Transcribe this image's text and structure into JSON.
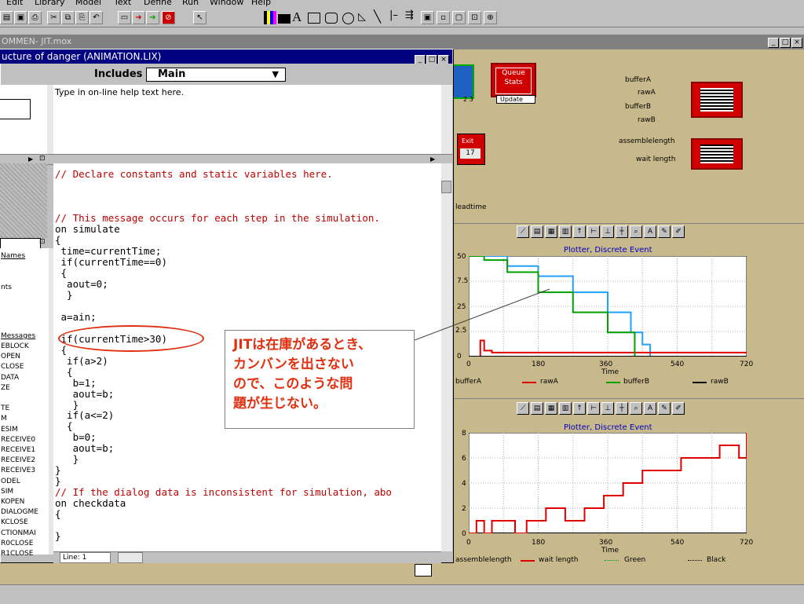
{
  "menubar": {
    "items": [
      "Edit",
      "Library",
      "Model",
      "Text",
      "Define",
      "Run",
      "Window",
      "Help"
    ]
  },
  "model_window": {
    "title": "OMMEN- JIT.mox"
  },
  "dialog": {
    "title": "ucture of danger (ANIMATION.LIX)",
    "includes_label": "Includes",
    "includes_value": "Main",
    "help_text": "Type in on-line help text here.",
    "line_label": "Line: 1",
    "side_links": {
      "names": "Names",
      "ents": "nts",
      "messages": "Messages"
    },
    "message_list": [
      "EBLOCK",
      "OPEN",
      "CLOSE",
      "DATA",
      "ZE",
      "",
      "TE",
      "M",
      "ESIM",
      "RECEIVE0",
      "RECEIVE1",
      "RECEIVE2",
      "RECEIVE3",
      "ODEL",
      "SIM",
      "KOPEN",
      "DIALOGME",
      "KCLOSE",
      "CTIONMAI",
      "R0CLOSE",
      "R1CLOSE"
    ],
    "code_lines": [
      {
        "text": "// Declare constants and static variables here.",
        "comment": true
      },
      {
        "text": "",
        "comment": false
      },
      {
        "text": "",
        "comment": false
      },
      {
        "text": "// This message occurs for each step in the simulation.",
        "comment": true
      },
      {
        "text": "on simulate",
        "comment": false
      },
      {
        "text": "{",
        "comment": false
      },
      {
        "text": " time=currentTime;",
        "comment": false
      },
      {
        "text": " if(currentTime==0)",
        "comment": false
      },
      {
        "text": " {",
        "comment": false
      },
      {
        "text": "  aout=0;",
        "comment": false
      },
      {
        "text": "  }",
        "comment": false
      },
      {
        "text": "",
        "comment": false
      },
      {
        "text": " a=ain;",
        "comment": false
      },
      {
        "text": "",
        "comment": false
      },
      {
        "text": " if(currentTime>30)",
        "comment": false
      },
      {
        "text": " {",
        "comment": false
      },
      {
        "text": "  if(a>2)",
        "comment": false
      },
      {
        "text": "  {",
        "comment": false
      },
      {
        "text": "   b=1;",
        "comment": false
      },
      {
        "text": "   aout=b;",
        "comment": false
      },
      {
        "text": "   }",
        "comment": false
      },
      {
        "text": "  if(a<=2)",
        "comment": false
      },
      {
        "text": "  {",
        "comment": false
      },
      {
        "text": "   b=0;",
        "comment": false
      },
      {
        "text": "   aout=b;",
        "comment": false
      },
      {
        "text": "   }",
        "comment": false
      },
      {
        "text": "}",
        "comment": false
      },
      {
        "text": "}",
        "comment": false
      },
      {
        "text": "// If the dialog data is inconsistent for simulation, abo",
        "comment": true
      },
      {
        "text": "on checkdata",
        "comment": false
      },
      {
        "text": "{",
        "comment": false
      },
      {
        "text": "",
        "comment": false
      },
      {
        "text": "}",
        "comment": false
      }
    ]
  },
  "annotation": {
    "lines": [
      "JITは在庫があるとき、",
      "カンバンを出さない",
      "ので、このような問",
      "題が生じない。"
    ],
    "color": "#e03010"
  },
  "blocks": {
    "queue_stats": {
      "line1": "Queue",
      "line2": "Stats",
      "update": "Update",
      "small_num": "2 3"
    },
    "exit": {
      "label": "Exit",
      "value": "17"
    },
    "leadtime": "leadtime",
    "top_inputs": [
      "bufferA",
      "rawA",
      "bufferB",
      "rawB"
    ],
    "bottom_inputs": [
      "assemblelength",
      "wait length"
    ]
  },
  "colors": {
    "background": "#c8b98c",
    "plot_frame": "#d00000",
    "title_bar": "#000080",
    "red": "#e00000",
    "green": "#00a000",
    "blue": "#20a0ff",
    "black": "#000000"
  },
  "chart_data": [
    {
      "type": "line",
      "title": "Plotter, Discrete Event",
      "xlabel": "Time",
      "ylabel": "",
      "xlim": [
        0,
        720
      ],
      "ylim": [
        0,
        50
      ],
      "x_ticks": [
        "0",
        "180",
        "360",
        "540",
        "720"
      ],
      "y_ticks": [
        "0",
        "2.5",
        "25",
        "7.5",
        "50"
      ],
      "series": [
        {
          "name": "bufferA",
          "color": "#20a0ff",
          "x": [
            0,
            60,
            100,
            180,
            270,
            360,
            420,
            450,
            470,
            720
          ],
          "y": [
            50,
            50,
            45,
            40,
            32,
            22,
            12,
            6,
            0,
            0
          ]
        },
        {
          "name": "rawA",
          "color": "#e00000",
          "x": [
            0,
            20,
            30,
            40,
            60,
            720
          ],
          "y": [
            0,
            0,
            8,
            3,
            2,
            2
          ]
        },
        {
          "name": "bufferB",
          "color": "#00a000",
          "x": [
            0,
            40,
            100,
            180,
            270,
            360,
            430,
            720
          ],
          "y": [
            50,
            48,
            42,
            32,
            22,
            12,
            0,
            0
          ]
        },
        {
          "name": "rawB",
          "color": "#000000",
          "x": [
            0,
            720
          ],
          "y": [
            0,
            0
          ]
        }
      ]
    },
    {
      "type": "line",
      "title": "Plotter, Discrete Event",
      "xlabel": "Time",
      "ylabel": "",
      "xlim": [
        0,
        720
      ],
      "ylim": [
        0,
        8
      ],
      "x_ticks": [
        "0",
        "180",
        "360",
        "540",
        "720"
      ],
      "y_ticks": [
        "0",
        "2",
        "4",
        "6",
        "8"
      ],
      "series": [
        {
          "name": "assemblelength",
          "color": "#000000",
          "x": [
            0,
            720
          ],
          "y": [
            0,
            0
          ]
        },
        {
          "name": "wait length",
          "color": "#e00000",
          "x": [
            0,
            20,
            40,
            60,
            90,
            120,
            150,
            200,
            250,
            300,
            350,
            400,
            450,
            500,
            550,
            600,
            650,
            700,
            720
          ],
          "y": [
            0,
            1,
            0,
            1,
            1,
            0,
            1,
            2,
            1,
            2,
            3,
            4,
            5,
            5,
            6,
            6,
            7,
            6,
            8
          ]
        },
        {
          "name": "Green",
          "color": "#00a000",
          "x": [],
          "y": []
        },
        {
          "name": "Black",
          "color": "#000000",
          "x": [],
          "y": []
        }
      ]
    }
  ]
}
